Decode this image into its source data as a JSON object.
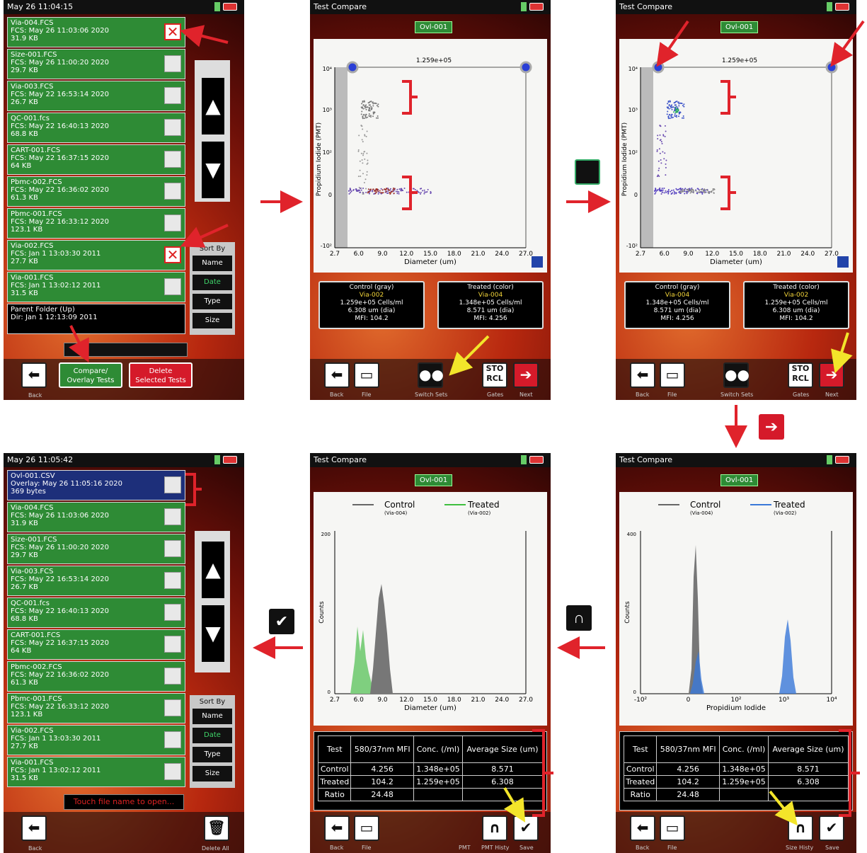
{
  "screenA": {
    "time": "May 26 11:04:15",
    "files": [
      {
        "name": "Via-004.FCS",
        "info": "FCS: May 26 11:03:06 2020",
        "size": "31.9 KB",
        "checked": true
      },
      {
        "name": "Size-001.FCS",
        "info": "FCS: May 26 11:00:20 2020",
        "size": "29.7 KB",
        "checked": false
      },
      {
        "name": "Via-003.FCS",
        "info": "FCS: May 22 16:53:14 2020",
        "size": "26.7 KB",
        "checked": false
      },
      {
        "name": "QC-001.fcs",
        "info": "FCS: May 22 16:40:13 2020",
        "size": "68.8 KB",
        "checked": false
      },
      {
        "name": "CART-001.FCS",
        "info": "FCS: May 22 16:37:15 2020",
        "size": "64 KB",
        "checked": false
      },
      {
        "name": "Pbmc-002.FCS",
        "info": "FCS: May 22 16:36:02 2020",
        "size": "61.3 KB",
        "checked": false
      },
      {
        "name": "Pbmc-001.FCS",
        "info": "FCS: May 22 16:33:12 2020",
        "size": "123.1 KB",
        "checked": false
      },
      {
        "name": "Via-002.FCS",
        "info": "FCS: Jan  1 13:03:30 2011",
        "size": "27.7 KB",
        "checked": true
      },
      {
        "name": "Via-001.FCS",
        "info": "FCS: Jan  1 13:02:12 2011",
        "size": "31.5 KB",
        "checked": false
      }
    ],
    "parent_title": "Parent Folder (Up)",
    "parent_dir": "Dir: Jan  1 12:13:09 2011",
    "sort_label": "Sort By",
    "sort_options": [
      "Name",
      "Date",
      "Type",
      "Size"
    ],
    "back_label": "Back",
    "compare_label_1": "Compare/",
    "compare_label_2": "Overlay Tests",
    "delete_label_1": "Delete",
    "delete_label_2": "Selected Tests"
  },
  "screenB": {
    "title": "Test Compare",
    "tag": "Ovl-001",
    "gate_value": "1.259e+05",
    "x_ticks": [
      "2.7",
      "6.0",
      "9.0",
      "12.0",
      "15.0",
      "18.0",
      "21.0",
      "24.0",
      "27.0"
    ],
    "xlabel": "Diameter (um)",
    "ylabel": "Propidium Iodide (PMT)",
    "y_ticks": [
      "10⁴",
      "10³",
      "10²",
      "0",
      "-10²"
    ],
    "control": {
      "title": "Control (gray)",
      "name": "Via-002",
      "conc": "1.259e+05 Cells/ml",
      "dia": "6.308 um (dia)",
      "mfi": "MFI: 104.2"
    },
    "treated": {
      "title": "Treated (color)",
      "name": "Via-004",
      "conc": "1.348e+05 Cells/ml",
      "dia": "8.571 um (dia)",
      "mfi": "MFI: 4.256"
    },
    "labels": {
      "back": "Back",
      "file": "File",
      "switch": "Switch Sets",
      "gates": "Gates",
      "next": "Next",
      "sto": "STO",
      "rcl": "RCL"
    }
  },
  "screenC": {
    "title": "Test Compare",
    "tag": "Ovl-001",
    "gate_value": "1.259e+05",
    "control": {
      "title": "Control (gray)",
      "name": "Via-004",
      "conc": "1.348e+05 Cells/ml",
      "dia": "8.571 um (dia)",
      "mfi": "MFI: 4.256"
    },
    "treated": {
      "title": "Treated (color)",
      "name": "Via-002",
      "conc": "1.259e+05 Cells/ml",
      "dia": "6.308 um (dia)",
      "mfi": "MFI: 104.2"
    }
  },
  "screenD": {
    "time": "May 26 11:05:42",
    "files": [
      {
        "name": "Ovl-001.CSV",
        "info": "Overlay: May 26 11:05:16 2020",
        "size": "369 bytes",
        "sel": true
      },
      {
        "name": "Via-004.FCS",
        "info": "FCS: May 26 11:03:06 2020",
        "size": "31.9 KB"
      },
      {
        "name": "Size-001.FCS",
        "info": "FCS: May 26 11:00:20 2020",
        "size": "29.7 KB"
      },
      {
        "name": "Via-003.FCS",
        "info": "FCS: May 22 16:53:14 2020",
        "size": "26.7 KB"
      },
      {
        "name": "QC-001.fcs",
        "info": "FCS: May 22 16:40:13 2020",
        "size": "68.8 KB"
      },
      {
        "name": "CART-001.FCS",
        "info": "FCS: May 22 16:37:15 2020",
        "size": "64 KB"
      },
      {
        "name": "Pbmc-002.FCS",
        "info": "FCS: May 22 16:36:02 2020",
        "size": "61.3 KB"
      },
      {
        "name": "Pbmc-001.FCS",
        "info": "FCS: May 22 16:33:12 2020",
        "size": "123.1 KB"
      },
      {
        "name": "Via-002.FCS",
        "info": "FCS: Jan  1 13:03:30 2011",
        "size": "27.7 KB"
      },
      {
        "name": "Via-001.FCS",
        "info": "FCS: Jan  1 13:02:12 2011",
        "size": "31.5 KB"
      }
    ],
    "touch_hint": "Touch file name to open...",
    "back_label": "Back",
    "delete_all_label": "Delete All"
  },
  "screenE": {
    "title": "Test Compare",
    "tag": "Ovl-001",
    "legend_control": "Control",
    "legend_control_sub": "(Via-004)",
    "legend_treated": "Treated",
    "legend_treated_sub": "(Via-002)",
    "ylabel": "Counts",
    "ymax": "200",
    "ymin": "0",
    "xlabel": "Diameter (um)",
    "x_ticks": [
      "2.7",
      "6.0",
      "9.0",
      "12.0",
      "15.0",
      "18.0",
      "21.0",
      "24.0",
      "27.0"
    ],
    "labels": {
      "back": "Back",
      "file": "File",
      "pmt": "PMT",
      "pmt_histy": "PMT Histy",
      "save": "Save"
    }
  },
  "screenF": {
    "title": "Test Compare",
    "tag": "Ovl-001",
    "legend_control": "Control",
    "legend_control_sub": "(Via-004)",
    "legend_treated": "Treated",
    "legend_treated_sub": "(Via-002)",
    "ylabel": "Counts",
    "ymax": "400",
    "ymin": "0",
    "xlabel": "Propidium Iodide",
    "x_ticks": [
      "-10²",
      "0",
      "10²",
      "10³",
      "10⁴"
    ],
    "labels": {
      "back": "Back",
      "file": "File",
      "size_histy": "Size Histy",
      "save": "Save"
    }
  },
  "table": {
    "headers": [
      "Test",
      "580/37nm MFI",
      "Conc. (/ml)",
      "Average Size (um)"
    ],
    "rows": [
      [
        "Control",
        "4.256",
        "1.348e+05",
        "8.571"
      ],
      [
        "Treated",
        "104.2",
        "1.259e+05",
        "6.308"
      ],
      [
        "Ratio",
        "24.48",
        "",
        ""
      ]
    ]
  },
  "colors": {
    "accent_red": "#e0232b",
    "highlight_yellow": "#f3e52a",
    "green_file": "#2e8b35",
    "blue_selected": "#1d2f7a"
  }
}
